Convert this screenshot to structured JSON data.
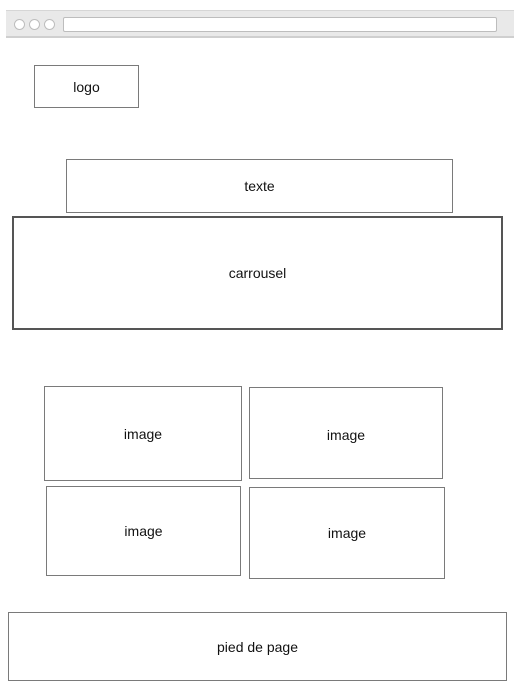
{
  "browser": {
    "buttons": [
      "close",
      "minimize",
      "maximize"
    ],
    "address": ""
  },
  "header": {
    "logo_label": "logo"
  },
  "intro": {
    "text_label": "texte"
  },
  "carousel": {
    "label": "carrousel"
  },
  "gallery": {
    "images": [
      {
        "label": "image"
      },
      {
        "label": "image"
      },
      {
        "label": "image"
      },
      {
        "label": "image"
      }
    ]
  },
  "footer": {
    "label": "pied de page"
  },
  "colors": {
    "border": "#7a7a7a",
    "browser_bar": "#e9e9e9",
    "background": "#ffffff"
  }
}
